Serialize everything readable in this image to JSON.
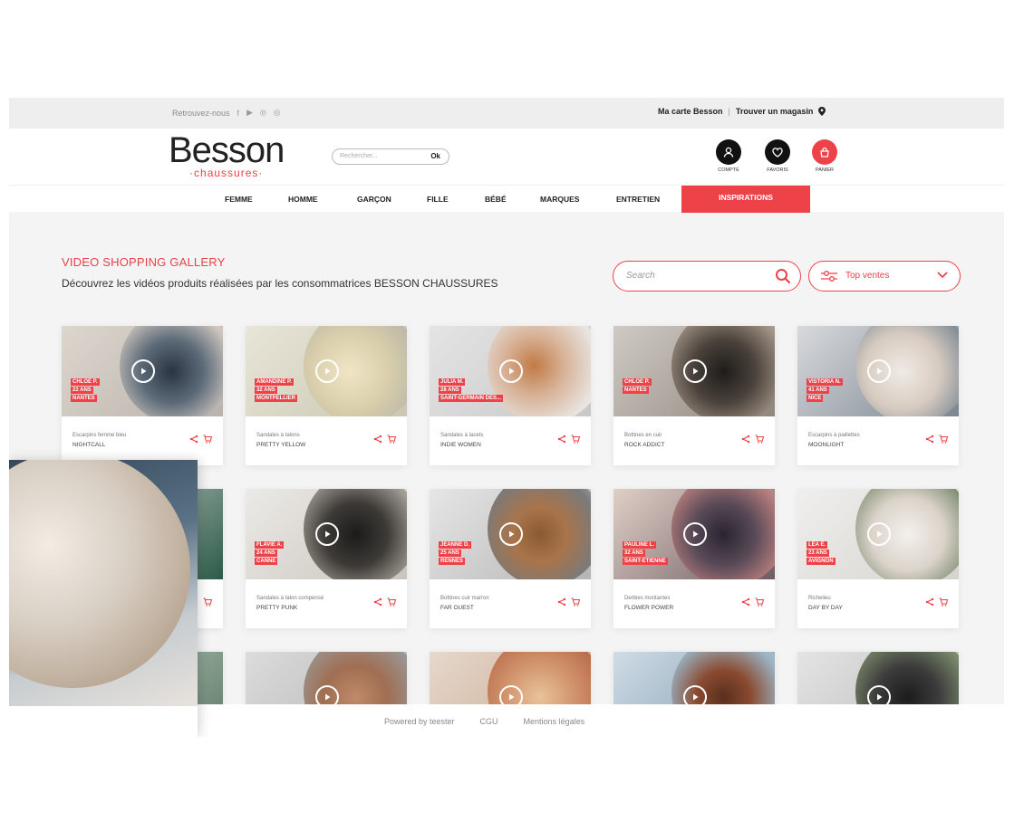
{
  "topbar": {
    "follow_label": "Retrouvez-nous",
    "social_icons": [
      "facebook-icon",
      "youtube-icon",
      "pinterest-icon",
      "instagram-icon"
    ],
    "card_link": "Ma carte Besson",
    "separator": "|",
    "store_link": "Trouver un magasin"
  },
  "header": {
    "logo_main": "Besson",
    "logo_sub": "·chaussures·",
    "search_placeholder": "Rechercher...",
    "search_button": "Ok",
    "icons": [
      {
        "label": "COMPTE",
        "icon": "user-icon",
        "color": "#111111"
      },
      {
        "label": "FAVORIS",
        "icon": "heart-icon",
        "color": "#111111"
      },
      {
        "label": "PANIER",
        "icon": "bag-icon",
        "color": "#ee4249"
      }
    ]
  },
  "nav": {
    "items": [
      "FEMME",
      "HOMME",
      "GARÇON",
      "FILLE",
      "BÉBÉ",
      "MARQUES",
      "ENTRETIEN"
    ],
    "active": "INSPIRATIONS"
  },
  "gallery": {
    "title": "VIDEO SHOPPING GALLERY",
    "subtitle": "Découvrez les vidéos produits réalisées par les consommatrices BESSON CHAUSSURES",
    "search_placeholder": "Search",
    "sort_label": "Top ventes",
    "accent": "#ee4249"
  },
  "cards": [
    {
      "tags": [
        "CHLOE P.",
        "22 ANS",
        "NANTES"
      ],
      "type": "Escarpins femme bleu",
      "name": "NIGHTCALL"
    },
    {
      "tags": [
        "AMANDINE P.",
        "32 ANS",
        "MONTPELLIER"
      ],
      "type": "Sandales à talons",
      "name": "PRETTY YELLOW"
    },
    {
      "tags": [
        "JULIA M.",
        "28 ANS",
        "SAINT-GERMAIN DES..."
      ],
      "type": "Sandales à lacets",
      "name": "INDIE WOMEN"
    },
    {
      "tags": [
        "CHLOE P.",
        "NANTES"
      ],
      "type": "Bottines en cuir",
      "name": "ROCK ADDICT"
    },
    {
      "tags": [
        "VISTORIA N.",
        "41 ANS",
        "NICE"
      ],
      "type": "Escarpins à paillettes",
      "name": "MOONLIGHT"
    },
    {
      "tags": [],
      "type": "",
      "name": ""
    },
    {
      "tags": [
        "FLAVIE A.",
        "24 ANS",
        "CANNE"
      ],
      "type": "Sandales à talon compensé",
      "name": "PRETTY PUNK"
    },
    {
      "tags": [
        "JEANNE D.",
        "25 ANS",
        "RENNES"
      ],
      "type": "Bottines cuir marron",
      "name": "FAR OUEST"
    },
    {
      "tags": [
        "PAULINE L.",
        "32 ANS",
        "SAINT-ETIENNE"
      ],
      "type": "Derbies montantes",
      "name": "FLOWER POWER"
    },
    {
      "tags": [
        "LEA E.",
        "23 ANS",
        "AVIGNON"
      ],
      "type": "Richelieu",
      "name": "DAY BY DAY"
    }
  ],
  "footer": {
    "powered": "Powered by teester",
    "cgu": "CGU",
    "legal": "Mentions légales"
  }
}
